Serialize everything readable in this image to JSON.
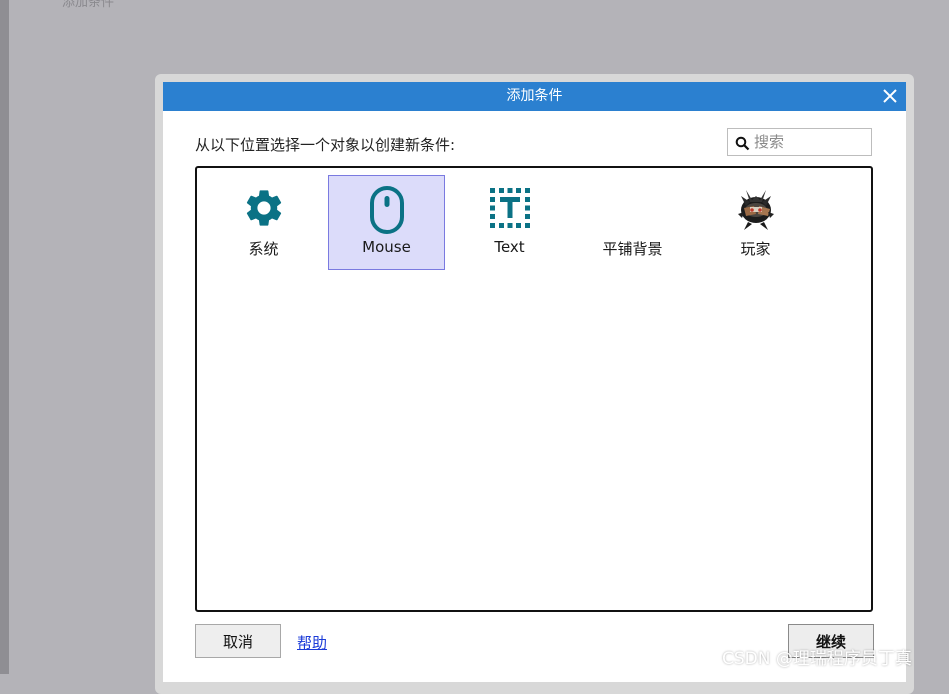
{
  "background": {
    "text": "添加条件"
  },
  "dialog": {
    "title": "添加条件",
    "prompt": "从以下位置选择一个对象以创建新条件:",
    "search": {
      "placeholder": "搜索",
      "value": ""
    },
    "objects": [
      {
        "label": "系统",
        "icon": "gear-icon",
        "selected": false
      },
      {
        "label": "Mouse",
        "icon": "mouse-icon",
        "selected": true
      },
      {
        "label": "Text",
        "icon": "text-object-icon",
        "selected": false
      },
      {
        "label": "平铺背景",
        "icon": "tiled-background-icon",
        "selected": false
      },
      {
        "label": "玩家",
        "icon": "player-sprite-icon",
        "selected": false
      }
    ],
    "buttons": {
      "cancel": "取消",
      "help": "帮助",
      "continue": "继续"
    }
  },
  "watermark": "CSDN @理瑞程序员丁真",
  "colors": {
    "titlebar": "#2b80d0",
    "accent_icon": "#0b7285",
    "selection": "#dcdcfa",
    "link": "#1a3ad8"
  }
}
